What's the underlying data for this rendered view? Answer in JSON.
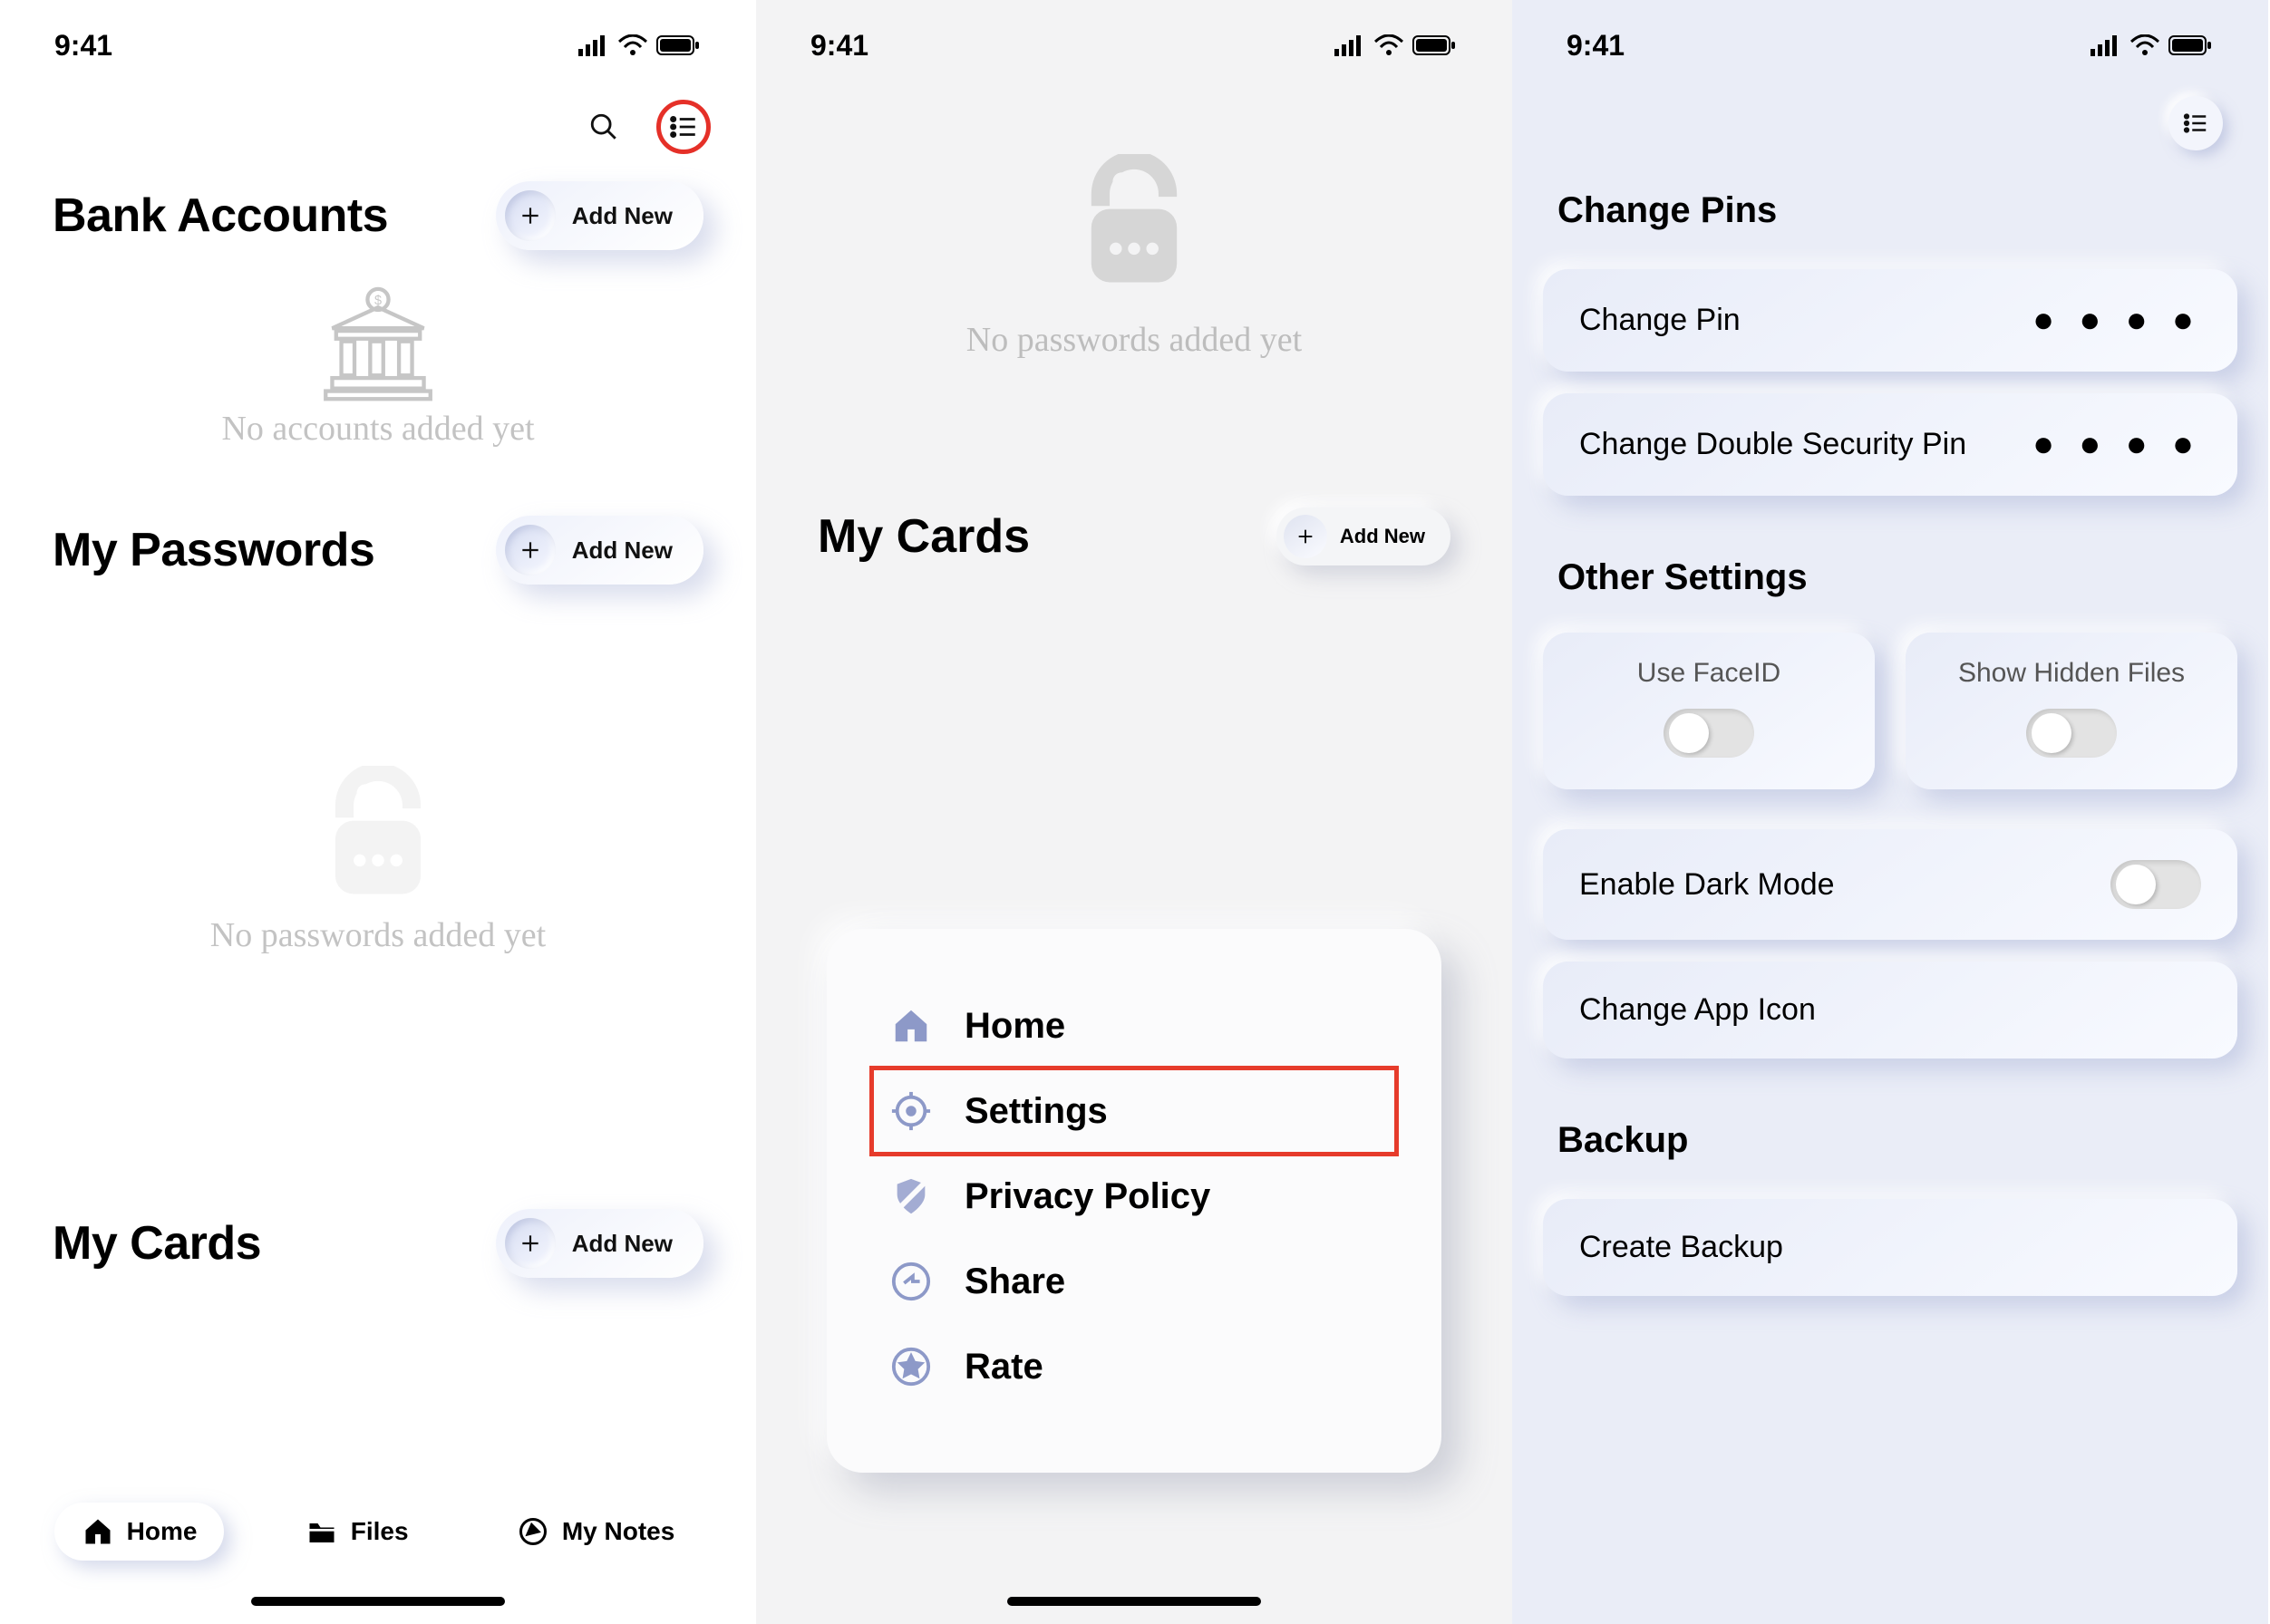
{
  "status": {
    "time": "9:41"
  },
  "screenA": {
    "sections": [
      {
        "title": "Bank Accounts",
        "add": "Add New",
        "empty": "No accounts added yet"
      },
      {
        "title": "My Passwords",
        "add": "Add New",
        "empty": "No passwords added yet"
      },
      {
        "title": "My Cards",
        "add": "Add New"
      }
    ],
    "tabs": [
      {
        "label": "Home",
        "active": true
      },
      {
        "label": "Files",
        "active": false
      },
      {
        "label": "My Notes",
        "active": false
      }
    ]
  },
  "screenB": {
    "empty": "No passwords added yet",
    "cards": {
      "title": "My Cards",
      "add": "Add New"
    },
    "menu": [
      {
        "label": "Home"
      },
      {
        "label": "Settings",
        "highlight": true
      },
      {
        "label": "Privacy Policy"
      },
      {
        "label": "Share"
      },
      {
        "label": "Rate"
      }
    ]
  },
  "screenC": {
    "sec1": {
      "title": "Change Pins",
      "items": [
        {
          "label": "Change Pin",
          "mask": "● ● ● ●"
        },
        {
          "label": "Change Double Security Pin",
          "mask": "● ● ● ●"
        }
      ]
    },
    "sec2": {
      "title": "Other Settings",
      "tiles": [
        {
          "label": "Use FaceID"
        },
        {
          "label": "Show Hidden Files"
        }
      ],
      "rows": [
        {
          "label": "Enable Dark Mode",
          "toggle": true
        },
        {
          "label": "Change App Icon"
        }
      ]
    },
    "sec3": {
      "title": "Backup",
      "rows": [
        {
          "label": "Create Backup"
        }
      ]
    }
  }
}
